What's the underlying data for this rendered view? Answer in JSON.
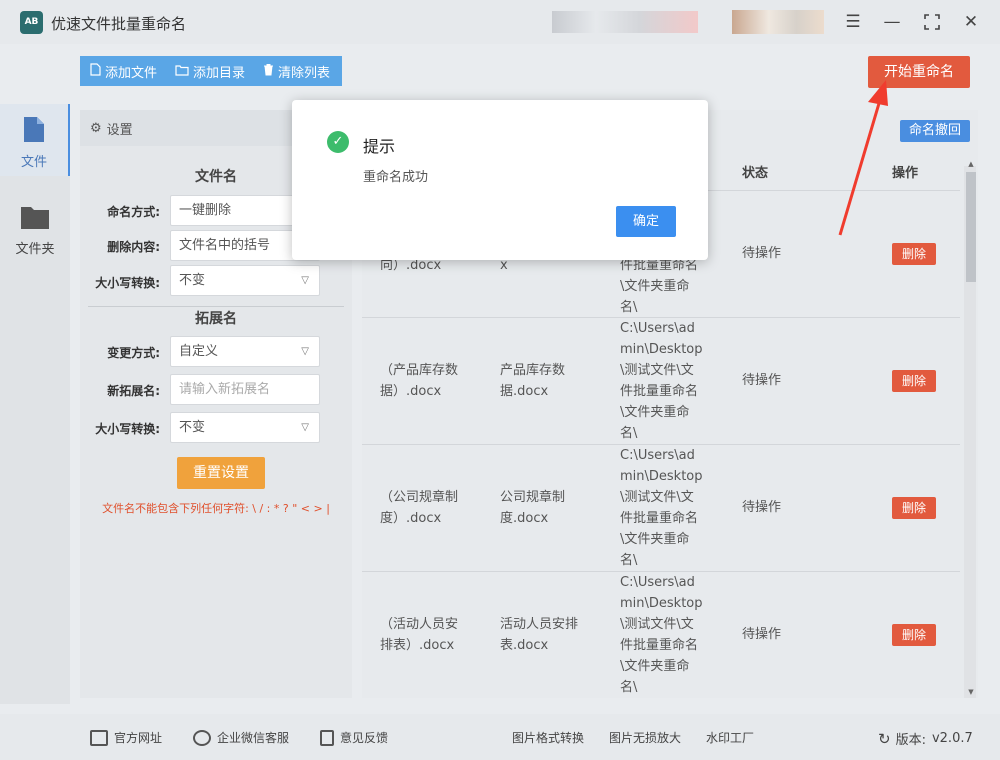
{
  "window": {
    "logo_text": "AB",
    "title": "优速文件批量重命名"
  },
  "toolbar": {
    "add_file": "添加文件",
    "add_dir": "添加目录",
    "clear_list": "清除列表",
    "start_rename": "开始重命名"
  },
  "sidebar": {
    "items": [
      {
        "label": "文件",
        "icon": "file-icon"
      },
      {
        "label": "文件夹",
        "icon": "folder-icon"
      }
    ]
  },
  "settings": {
    "header": "设置",
    "filename_section": "文件名",
    "naming_mode_label": "命名方式:",
    "naming_mode_value": "一键删除",
    "delete_content_label": "删除内容:",
    "delete_content_value": "文件名中的括号",
    "case_label": "大小写转换:",
    "case_value": "不变",
    "ext_section": "拓展名",
    "change_mode_label": "变更方式:",
    "change_mode_value": "自定义",
    "new_ext_label": "新拓展名:",
    "new_ext_placeholder": "请输入新拓展名",
    "ext_case_label": "大小写转换:",
    "ext_case_value": "不变",
    "reset_button": "重置设置",
    "warning": "文件名不能包含下列任何字符: \\ / : * ? \" < > |"
  },
  "table": {
    "undo_button": "命名撤回",
    "headers": {
      "status": "状态",
      "action": "操作"
    },
    "partial_row": {
      "col1": "向）.docx",
      "col2": "x",
      "col3": [
        "件批量重命名",
        "\\文件夹重命",
        "名\\"
      ],
      "status": "待操作",
      "action": "删除"
    },
    "rows": [
      {
        "col1": [
          "（产品库存数",
          "据）.docx"
        ],
        "col2": [
          "产品库存数",
          "据.docx"
        ],
        "col3": [
          "C:\\Users\\ad",
          "min\\Desktop",
          "\\测试文件\\文",
          "件批量重命名",
          "\\文件夹重命",
          "名\\"
        ],
        "status": "待操作",
        "action": "删除"
      },
      {
        "col1": [
          "（公司规章制",
          "度）.docx"
        ],
        "col2": [
          "公司规章制",
          "度.docx"
        ],
        "col3": [
          "C:\\Users\\ad",
          "min\\Desktop",
          "\\测试文件\\文",
          "件批量重命名",
          "\\文件夹重命",
          "名\\"
        ],
        "status": "待操作",
        "action": "删除"
      },
      {
        "col1": [
          "（活动人员安",
          "排表）.docx"
        ],
        "col2": [
          "活动人员安排",
          "表.docx"
        ],
        "col3": [
          "C:\\Users\\ad",
          "min\\Desktop",
          "\\测试文件\\文",
          "件批量重命名",
          "\\文件夹重命",
          "名\\"
        ],
        "status": "待操作",
        "action": "删除"
      }
    ]
  },
  "dialog": {
    "title": "提示",
    "message": "重命名成功",
    "ok_button": "确定"
  },
  "footer": {
    "official_site": "官方网址",
    "wechat_support": "企业微信客服",
    "feedback": "意见反馈",
    "img_convert": "图片格式转换",
    "img_enlarge": "图片无损放大",
    "watermark": "水印工厂",
    "version_label": "版本:",
    "version_value": "v2.0.7"
  },
  "colors": {
    "accent_blue": "#4a8ee0",
    "start_red": "#e25a3e",
    "reset_orange": "#f0a23c",
    "success_green": "#3dbc6c"
  }
}
